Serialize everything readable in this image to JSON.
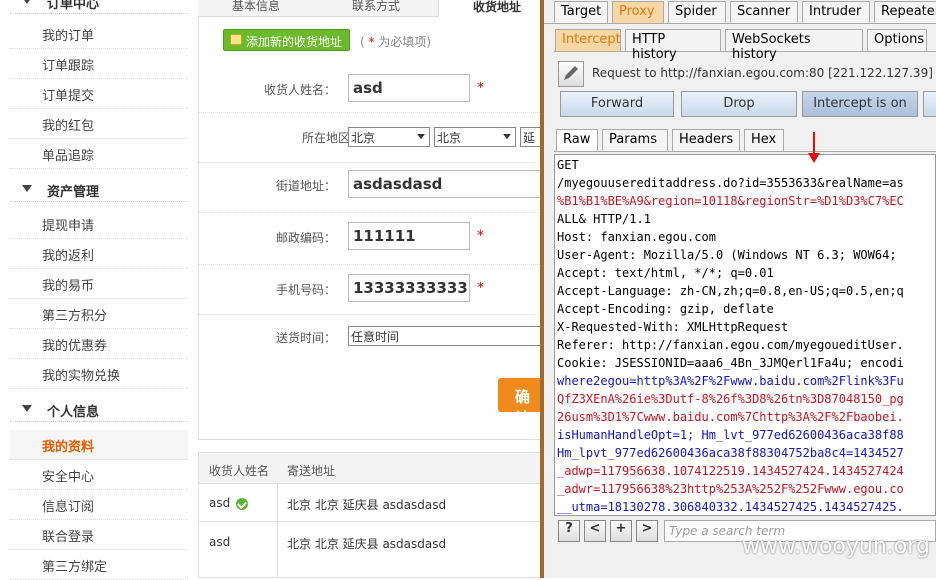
{
  "sidebar": {
    "top_item": "订单中心",
    "group1_items": [
      "我的订单",
      "订单跟踪",
      "订单提交",
      "我的红包",
      "单品追踪"
    ],
    "group2_title": "资产管理",
    "group2_items": [
      "提现申请",
      "我的返利",
      "我的易币",
      "第三方积分",
      "我的优惠券",
      "我的实物兑换"
    ],
    "group3_title": "个人信息",
    "group3_items": [
      "我的资料",
      "安全中心",
      "信息订阅",
      "联合登录",
      "第三方绑定"
    ]
  },
  "form": {
    "tabs": [
      "基本信息",
      "联系方式",
      "收货地址"
    ],
    "add_button": "添加新的收货地址",
    "required_note_star": "*",
    "required_note": "为必填项",
    "name_label": "收货人姓名：",
    "name_value": "asd",
    "region_label": "所在地区：",
    "province": "北京",
    "city": "北京",
    "county": "延",
    "street_label": "街道地址：",
    "street_value": "asdasdasd",
    "zip_label": "邮政编码：",
    "zip_value": "111111",
    "phone_label": "手机号码：",
    "phone_value": "13333333333",
    "time_label": "送货时间：",
    "time_value": "任意时间",
    "star": "*",
    "confirm": "确认"
  },
  "address_table": {
    "headers": [
      "收货人姓名",
      "寄送地址"
    ],
    "rows": [
      {
        "name": "asd",
        "address": "北京 北京 延庆县 asdasdasd"
      },
      {
        "name": "asd",
        "address": "北京 北京 延庆县 asdasdasd"
      }
    ]
  },
  "burp": {
    "tabs": [
      "Target",
      "Proxy",
      "Spider",
      "Scanner",
      "Intruder",
      "Repeater"
    ],
    "subtabs": [
      "Intercept",
      "HTTP history",
      "WebSockets history",
      "Options"
    ],
    "request_info": "Request to http://fanxian.egou.com:80  [221.122.127.39]",
    "buttons": [
      "Forward",
      "Drop",
      "Intercept is on"
    ],
    "view_tabs": [
      "Raw",
      "Params",
      "Headers",
      "Hex"
    ],
    "lines": [
      "GET",
      "/myegouusereditaddress.do?id=3553633&realName=as",
      "%B1%B1%BE%A9&region=10118&regionStr=%D1%D3%C7%EC",
      "ALL& HTTP/1.1",
      "Host: fanxian.egou.com",
      "User-Agent: Mozilla/5.0 (Windows NT 6.3; WOW64;",
      "Accept: text/html, */*; q=0.01",
      "Accept-Language: zh-CN,zh;q=0.8,en-US;q=0.5,en;q",
      "Accept-Encoding: gzip, deflate",
      "X-Requested-With: XMLHttpRequest",
      "Referer: http://fanxian.egou.com/myegoueditUser.",
      "Cookie: JSESSIONID=aaa6_4Bn_3JMQerl1Fa4u; encodi",
      "where2egou=http%3A%2F%2Fwww.baidu.com%2Flink%3Fu",
      "QfZ3XEnA%26ie%3Dutf-8%26f%3D8%26tn%3D87048150_pg",
      "26usm%3D1%7Cwww.baidu.com%7Chttp%3A%2F%2Fbaobei.",
      "isHumanHandleOpt=1; Hm_lvt_977ed62600436aca38f88",
      "Hm_lpvt_977ed62600436aca38f88304752ba8c4=1434527",
      "_adwp=117956638.1074122519.1434527424.1434527424",
      "_adwr=117956638%23http%253A%252F%252Fwww.egou.co",
      "__utma=18130278.306840332.1434527425.1434527425."
    ],
    "bottom_buttons": [
      "?",
      "<",
      "+",
      ">"
    ],
    "search_placeholder": "Type a search term"
  },
  "watermark": "www.wooyun.org"
}
